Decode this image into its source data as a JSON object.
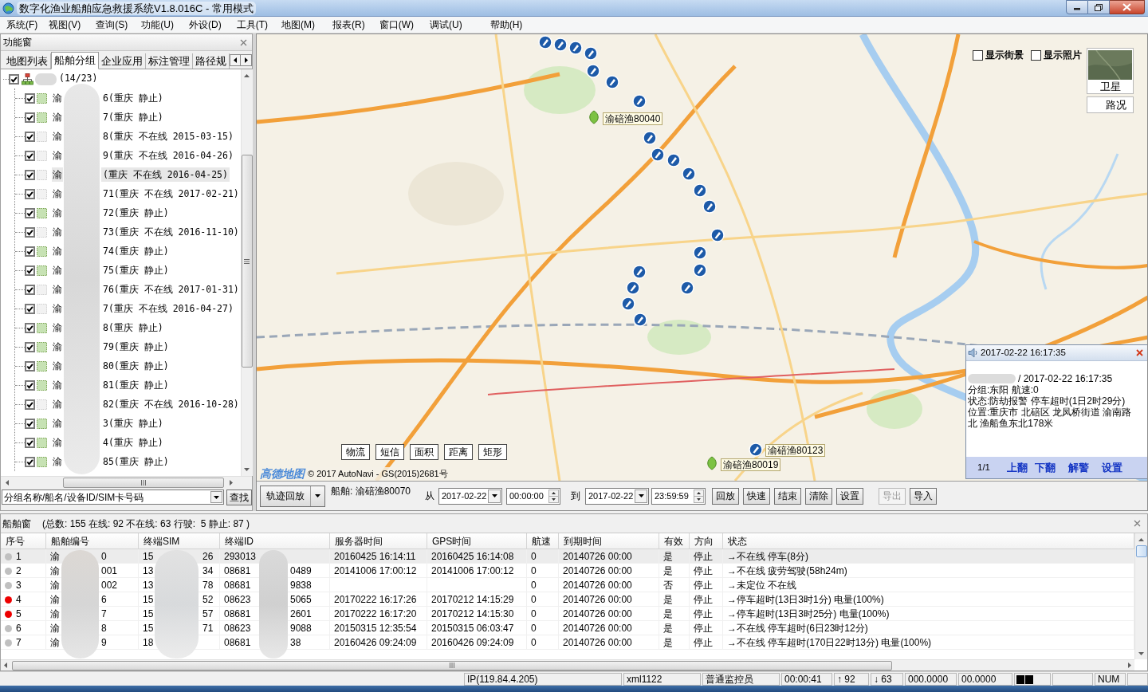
{
  "window": {
    "title": "数字化渔业船舶应急救援系统V1.8.016C - 常用模式"
  },
  "menu": [
    "系统(F)",
    "视图(V)",
    "查询(S)",
    "功能(U)",
    "外设(D)",
    "工具(T)",
    "地图(M)",
    "报表(R)",
    "窗口(W)",
    "调试(U)",
    "帮助(H)"
  ],
  "left_panel": {
    "title": "功能窗",
    "tabs": [
      {
        "label": "地图列表",
        "selected": false
      },
      {
        "label": "船舶分组",
        "selected": true
      },
      {
        "label": "企业应用",
        "selected": false
      },
      {
        "label": "标注管理",
        "selected": false
      },
      {
        "label": "路径规",
        "selected": false
      }
    ],
    "tree": {
      "checked": true,
      "label_end": "(14/23)",
      "children": [
        {
          "start": "渝",
          "end": "6(重庆 静止)",
          "checked": true,
          "online": true,
          "selected": false
        },
        {
          "start": "渝",
          "end": "7(重庆 静止)",
          "checked": true,
          "online": true,
          "selected": false
        },
        {
          "start": "渝",
          "end": "8(重庆 不在线 2015-03-15)",
          "checked": true,
          "online": false,
          "selected": false
        },
        {
          "start": "渝",
          "end": "9(重庆 不在线 2016-04-26)",
          "checked": true,
          "online": false,
          "selected": false
        },
        {
          "start": "渝",
          "end": "(重庆 不在线 2016-04-25)",
          "checked": true,
          "online": false,
          "selected": true
        },
        {
          "start": "渝",
          "end": "71(重庆 不在线 2017-02-21)",
          "checked": true,
          "online": false,
          "selected": false
        },
        {
          "start": "渝",
          "end": "72(重庆 静止)",
          "checked": true,
          "online": true,
          "selected": false
        },
        {
          "start": "渝",
          "end": "73(重庆 不在线 2016-11-10)",
          "checked": true,
          "online": false,
          "selected": false
        },
        {
          "start": "渝",
          "end": "74(重庆 静止)",
          "checked": true,
          "online": true,
          "selected": false
        },
        {
          "start": "渝",
          "end": "75(重庆 静止)",
          "checked": true,
          "online": true,
          "selected": false
        },
        {
          "start": "渝",
          "end": "76(重庆 不在线 2017-01-31)",
          "checked": true,
          "online": false,
          "selected": false
        },
        {
          "start": "渝",
          "end": "7(重庆 不在线 2016-04-27)",
          "checked": true,
          "online": false,
          "selected": false
        },
        {
          "start": "渝",
          "end": "8(重庆 静止)",
          "checked": true,
          "online": true,
          "selected": false
        },
        {
          "start": "渝",
          "end": "79(重庆 静止)",
          "checked": true,
          "online": true,
          "selected": false
        },
        {
          "start": "渝",
          "end": "80(重庆 静止)",
          "checked": true,
          "online": true,
          "selected": false
        },
        {
          "start": "渝",
          "end": "81(重庆 静止)",
          "checked": true,
          "online": true,
          "selected": false
        },
        {
          "start": "渝",
          "end": "82(重庆 不在线 2016-10-28)",
          "checked": true,
          "online": false,
          "selected": false
        },
        {
          "start": "渝",
          "end": "3(重庆 静止)",
          "checked": true,
          "online": true,
          "selected": false
        },
        {
          "start": "渝",
          "end": "4(重庆 静止)",
          "checked": true,
          "online": true,
          "selected": false
        },
        {
          "start": "渝",
          "end": "85(重庆 静止)",
          "checked": true,
          "online": true,
          "selected": false
        }
      ]
    },
    "search": {
      "value": "分组名称/船名/设备ID/SIM卡号码",
      "button": "查找"
    }
  },
  "map": {
    "street_view": {
      "label": "显示街景",
      "checked": false
    },
    "photos": {
      "label": "显示照片",
      "checked": false
    },
    "layers": [
      {
        "label": "卫星",
        "kind": "thumbnail"
      },
      {
        "label": "路况",
        "kind": "plain"
      }
    ],
    "tools": [
      "物流",
      "短信",
      "面积",
      "距离",
      "矩形"
    ],
    "logo": "高德地图",
    "copyright": "© 2017 AutoNavi - GS(2015)2681号",
    "markers": [
      {
        "kind": "pin"
      },
      {
        "kind": "pin"
      },
      {
        "kind": "pin"
      },
      {
        "kind": "pin"
      },
      {
        "kind": "pin"
      },
      {
        "kind": "pin"
      },
      {
        "kind": "pin"
      },
      {
        "kind": "pin"
      },
      {
        "kind": "pin"
      },
      {
        "kind": "pin"
      },
      {
        "kind": "pin"
      },
      {
        "kind": "pin"
      },
      {
        "kind": "pin"
      },
      {
        "kind": "pin"
      },
      {
        "kind": "pin"
      },
      {
        "kind": "pin"
      },
      {
        "kind": "pin"
      },
      {
        "kind": "pin"
      },
      {
        "kind": "pin"
      },
      {
        "kind": "pin"
      },
      {
        "kind": "pin"
      },
      {
        "kind": "leaf",
        "label": "渝碚渔80040"
      },
      {
        "kind": "pin",
        "label": "渝碚渔80123"
      },
      {
        "kind": "leaf",
        "label": "渝碚渔80019"
      }
    ],
    "alert": {
      "time": "2017-02-22 16:17:35",
      "vessel_end": "/ 2017-02-22 16:17:35",
      "details": [
        "分组:东阳 航速:0",
        "状态:防劫报警 停车超时(1日2时29分)",
        "位置:重庆市 北碚区 龙凤桥街道 渝南路北 渔船鱼东北178米"
      ],
      "page": "1/1",
      "actions": [
        "上翻",
        "下翻",
        "解警",
        "设置"
      ]
    }
  },
  "playback": {
    "mode": "轨迹回放",
    "ship": "船舶: 渝碚渔80070",
    "from_label": "从",
    "from_date": "2017-02-22",
    "from_time": "00:00:00",
    "to_label": "到",
    "to_date": "2017-02-22",
    "to_time": "23:59:59",
    "buttons": [
      {
        "label": "回放",
        "disabled": false
      },
      {
        "label": "快速",
        "disabled": false
      },
      {
        "label": "结束",
        "disabled": false
      },
      {
        "label": "清除",
        "disabled": false
      },
      {
        "label": "设置",
        "disabled": false
      },
      {
        "label": "导出",
        "disabled": true
      },
      {
        "label": "导入",
        "disabled": false
      }
    ]
  },
  "ship_window": {
    "title": "船舶窗",
    "summary": "(总数: 155 在线: 92 不在线: 63 行驶:  5 静止: 87 )",
    "columns": [
      "序号",
      "船舶编号",
      "终端SIM",
      "终端ID",
      "服务器时间",
      "GPS时间",
      "航速",
      "到期时间",
      "有效",
      "方向",
      "状态"
    ],
    "rows": [
      {
        "selected": true,
        "color": "#c0c0c0",
        "index": "1",
        "ship_no": {
          "start": "渝",
          "end": "0"
        },
        "sim": {
          "start": "15",
          "end": "26"
        },
        "terminal_id": {
          "start": "293013"
        },
        "server_time": "20160425 16:14:11",
        "gps_time": "20160425 16:14:08",
        "speed": "0",
        "expiry": "20140726 00:00",
        "valid": "是",
        "direction": "停止",
        "status": "→不在线 停车(8分)"
      },
      {
        "selected": false,
        "color": "#c0c0c0",
        "index": "2",
        "ship_no": {
          "start": "渝",
          "end": "001"
        },
        "sim": {
          "start": "13",
          "end": "34"
        },
        "terminal_id": {
          "start": "08681",
          "end": "0489"
        },
        "server_time": "20141006 17:00:12",
        "gps_time": "20141006 17:00:12",
        "speed": "0",
        "expiry": "20140726 00:00",
        "valid": "是",
        "direction": "停止",
        "status": "→不在线 疲劳驾驶(58h24m)"
      },
      {
        "selected": false,
        "color": "#c0c0c0",
        "index": "3",
        "ship_no": {
          "start": "渝",
          "end": "002"
        },
        "sim": {
          "start": "13",
          "end": "78"
        },
        "terminal_id": {
          "start": "08681",
          "end": "9838"
        },
        "speed": "0",
        "expiry": "20140726 00:00",
        "valid": "否",
        "direction": "停止",
        "status": "→未定位 不在线"
      },
      {
        "selected": false,
        "color": "#ee0000",
        "index": "4",
        "ship_no": {
          "start": "渝",
          "end": "6"
        },
        "sim": {
          "start": "15",
          "end": "52"
        },
        "terminal_id": {
          "start": "08623",
          "end": "5065"
        },
        "server_time": "20170222 16:17:26",
        "gps_time": "20170212 14:15:29",
        "speed": "0",
        "expiry": "20140726 00:00",
        "valid": "是",
        "direction": "停止",
        "status": "→停车超时(13日3时1分) 电量(100%)"
      },
      {
        "selected": false,
        "color": "#ee0000",
        "index": "5",
        "ship_no": {
          "start": "渝",
          "end": "7"
        },
        "sim": {
          "start": "15",
          "end": "57"
        },
        "terminal_id": {
          "start": "08681",
          "end": "2601"
        },
        "server_time": "20170222 16:17:20",
        "gps_time": "20170212 14:15:30",
        "speed": "0",
        "expiry": "20140726 00:00",
        "valid": "是",
        "direction": "停止",
        "status": "→停车超时(13日3时25分) 电量(100%)"
      },
      {
        "selected": false,
        "color": "#c0c0c0",
        "index": "6",
        "ship_no": {
          "start": "渝",
          "end": "8"
        },
        "sim": {
          "start": "15",
          "end": "71"
        },
        "terminal_id": {
          "start": "08623",
          "end": "9088"
        },
        "server_time": "20150315 12:35:54",
        "gps_time": "20150315 06:03:47",
        "speed": "0",
        "expiry": "20140726 00:00",
        "valid": "是",
        "direction": "停止",
        "status": "→不在线 停车超时(6日23时12分)"
      },
      {
        "selected": false,
        "color": "#c0c0c0",
        "index": "7",
        "ship_no": {
          "start": "渝",
          "end": "9"
        },
        "sim": {
          "start": "18"
        },
        "terminal_id": {
          "start": "08681",
          "end": "38"
        },
        "server_time": "20160426 09:24:09",
        "gps_time": "20160426 09:24:09",
        "speed": "0",
        "expiry": "20140726 00:00",
        "valid": "是",
        "direction": "停止",
        "status": "→不在线 停车超时(170日22时13分) 电量(100%)"
      }
    ]
  },
  "status_bar": [
    {
      "kind": "spacer"
    },
    {
      "kind": "text",
      "text": "IP(119.84.4.205)"
    },
    {
      "kind": "text",
      "text": "xml1122"
    },
    {
      "kind": "text",
      "text": "普通监控员"
    },
    {
      "kind": "text",
      "text": "00:00:41"
    },
    {
      "kind": "text",
      "text": "↑ 92"
    },
    {
      "kind": "text",
      "text": "↓ 63"
    },
    {
      "kind": "text",
      "text": "000.0000"
    },
    {
      "kind": "text",
      "text": "00.0000"
    },
    {
      "kind": "blocks"
    },
    {
      "kind": "blank"
    },
    {
      "kind": "text",
      "text": "NUM"
    },
    {
      "kind": "blank"
    }
  ]
}
